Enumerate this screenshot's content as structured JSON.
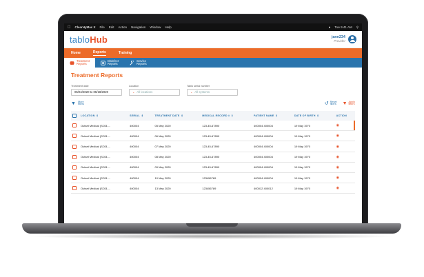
{
  "menubar": {
    "app": "ClearHyMac X",
    "items": [
      "File",
      "Edit",
      "Action",
      "Navigation",
      "Window",
      "Help"
    ],
    "clock": "Tue 9:41 AM"
  },
  "header": {
    "logo_a": "tablo",
    "logo_b": "Hub",
    "user_name": "jane234",
    "user_role": "Provider"
  },
  "main_nav": [
    "Home",
    "Reports",
    "Training"
  ],
  "sub_nav": [
    {
      "label_1": "Treatment",
      "label_2": "Reports"
    },
    {
      "label_1": "Disinfect",
      "label_2": "Reports"
    },
    {
      "label_1": "Service",
      "label_2": "Reports"
    }
  ],
  "page_title": "Treatment Reports",
  "filters": {
    "date_label": "Treatment date",
    "date_value": "05/04/2020 to 05/18/2020",
    "location_label": "Location",
    "location_value": "All locations",
    "serial_label": "Tablo serial number",
    "serial_value": "All systems"
  },
  "toolbar": {
    "more_1": "More",
    "more_2": "filters",
    "reset_1": "Reset",
    "reset_2": "filters",
    "apply_1": "Apply",
    "apply_2": "filters"
  },
  "table": {
    "headers": [
      "LOCATION",
      "SERIAL",
      "TREATMENT DATE",
      "MEDICAL RECORD #",
      "PATIENT NAME",
      "DATE OF BIRTH",
      "ACTION"
    ],
    "rows": [
      [
        "Outset Medical (SOI3-...",
        "400004",
        "05 May 2020",
        "123-45-67890",
        "400004 400004",
        "19 May 1970"
      ],
      [
        "Outset Medical (SOI3-...",
        "400004",
        "06 May 2020",
        "123-45-67890",
        "400004 400004",
        "19 May 1970"
      ],
      [
        "Outset Medical (SOI3-...",
        "400004",
        "07 May 2020",
        "123-45-67890",
        "400004 400004",
        "19 May 1970"
      ],
      [
        "Outset Medical (SOI3-...",
        "400004",
        "08 May 2020",
        "123-45-67890",
        "400004 400004",
        "19 May 1970"
      ],
      [
        "Outset Medical (SOI3-...",
        "400004",
        "09 May 2020",
        "123-45-67890",
        "400004 400004",
        "19 May 1970"
      ],
      [
        "Outset Medical (SOI3-...",
        "400004",
        "10 May 2020",
        "123456789",
        "400004 400004",
        "19 May 1970"
      ],
      [
        "Outset Medical (SOI3-...",
        "400004",
        "13 May 2020",
        "123456789",
        "400012 400012",
        "19 May 1970"
      ]
    ]
  },
  "colors": {
    "accent_orange": "#ec6b29",
    "nav_blue": "#2a74ad",
    "logo_blue": "#3b87c6"
  }
}
